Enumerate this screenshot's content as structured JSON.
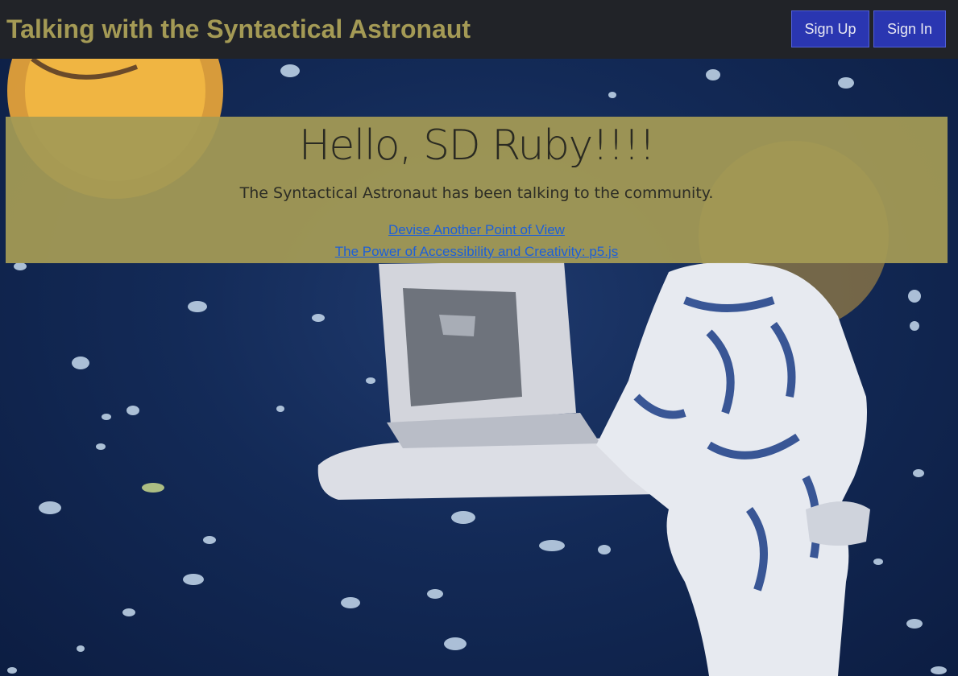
{
  "navbar": {
    "brand": "Talking with the Syntactical Astronaut",
    "signup_label": "Sign Up",
    "signin_label": "Sign In"
  },
  "hero": {
    "headline": "Hello, SD Ruby!!!!",
    "lead": "The Syntactical Astronaut has been talking to the community.",
    "links": [
      {
        "label": "Devise Another Point of View"
      },
      {
        "label": "The Power of Accessibility and Creativity: p5.js"
      }
    ]
  },
  "colors": {
    "navbar_bg": "#212328",
    "brand": "#a49a55",
    "button_bg": "#2a36b1",
    "panel_bg": "#a49a55",
    "link": "#1d5fd8",
    "space": "#132a57"
  }
}
